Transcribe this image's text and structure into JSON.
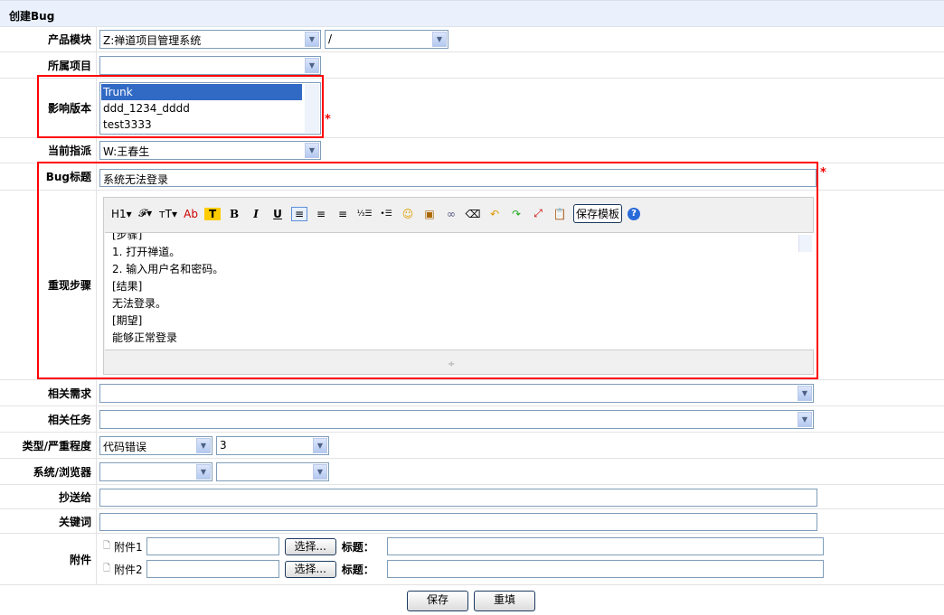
{
  "header": {
    "title": "创建Bug"
  },
  "labels": {
    "product_module": "产品模块",
    "project": "所属项目",
    "build": "影响版本",
    "assigned": "当前指派",
    "bug_title": "Bug标题",
    "steps": "重现步骤",
    "story": "相关需求",
    "task": "相关任务",
    "type_severity": "类型/严重程度",
    "os_browser": "系统/浏览器",
    "mailto": "抄送给",
    "keywords": "关键词",
    "files": "附件"
  },
  "fields": {
    "product": "Z:禅道项目管理系统",
    "module": "/",
    "project": "",
    "builds": [
      "Trunk",
      "ddd_1234_dddd",
      "test3333"
    ],
    "assigned": "W:王春生",
    "title": "系统无法登录",
    "type": "代码错误",
    "severity": "3",
    "required_mark": "*"
  },
  "editor": {
    "toolbar": [
      "H1▾",
      "𝓕▾",
      "ᴛT▾",
      "Ab",
      "T",
      "B",
      "I",
      "U",
      "≡",
      "≡",
      "≡",
      "⅓☰",
      "•☰",
      "☺",
      "▣",
      "∞",
      "⌫",
      "↶",
      "↷",
      "⤢",
      "📋"
    ],
    "save_template": "保存模板",
    "help": "?",
    "lines": [
      "[步骤]",
      "1. 打开禅道。",
      "2. 输入用户名和密码。",
      "[结果]",
      "无法登录。",
      "[期望]",
      "能够正常登录"
    ]
  },
  "files": [
    {
      "label": "附件1",
      "browse": "选择...",
      "title_label": "标题："
    },
    {
      "label": "附件2",
      "browse": "选择...",
      "title_label": "标题："
    }
  ],
  "actions": {
    "save": "保存",
    "reset": "重填"
  }
}
